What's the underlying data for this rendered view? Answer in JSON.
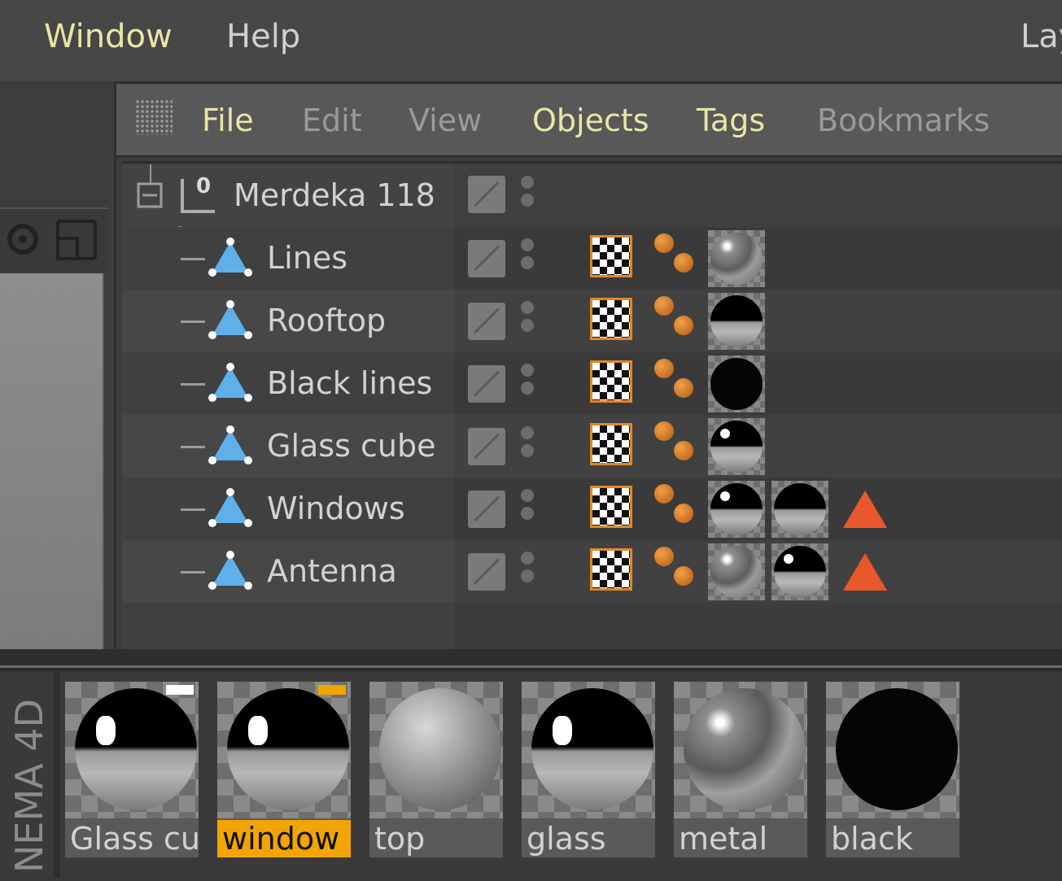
{
  "colors": {
    "accent_yellow": "#e9e6a6",
    "menu_text": "#cfcfcf",
    "dim_text": "#9a9a9a",
    "selection": "#f2a500",
    "warning": "#e8582c",
    "tag_orange": "#e0862a"
  },
  "top_menu": {
    "window": "Window",
    "help": "Help",
    "layout": "Lay"
  },
  "object_manager": {
    "menu": [
      "File",
      "Edit",
      "View",
      "Objects",
      "Tags",
      "Bookmarks"
    ],
    "root": {
      "name": "Merdeka 118",
      "layer": "0"
    },
    "objects": [
      {
        "name": "Lines",
        "materials": [
          "metal"
        ],
        "warning": false
      },
      {
        "name": "Rooftop",
        "materials": [
          "top"
        ],
        "warning": false
      },
      {
        "name": "Black lines",
        "materials": [
          "black"
        ],
        "warning": false
      },
      {
        "name": "Glass cube",
        "materials": [
          "glass"
        ],
        "warning": false
      },
      {
        "name": "Windows",
        "materials": [
          "window",
          "top"
        ],
        "warning": true
      },
      {
        "name": "Antenna",
        "materials": [
          "metal",
          "glass"
        ],
        "warning": true
      }
    ],
    "icons": {
      "object": "polygon-object-icon",
      "texture_tag": "uvw-texture-tag-icon",
      "phong_tag": "phong-tag-icon",
      "warning": "warning-triangle-icon"
    }
  },
  "material_manager": {
    "brand": "NEMA 4D",
    "materials": [
      {
        "label": "Glass cu",
        "type": "glass",
        "selected": false
      },
      {
        "label": "window",
        "type": "glass",
        "selected": true
      },
      {
        "label": "top",
        "type": "diffuse",
        "selected": false
      },
      {
        "label": "glass",
        "type": "glass",
        "selected": false
      },
      {
        "label": "metal",
        "type": "metal",
        "selected": false
      },
      {
        "label": "black",
        "type": "black",
        "selected": false
      }
    ]
  }
}
